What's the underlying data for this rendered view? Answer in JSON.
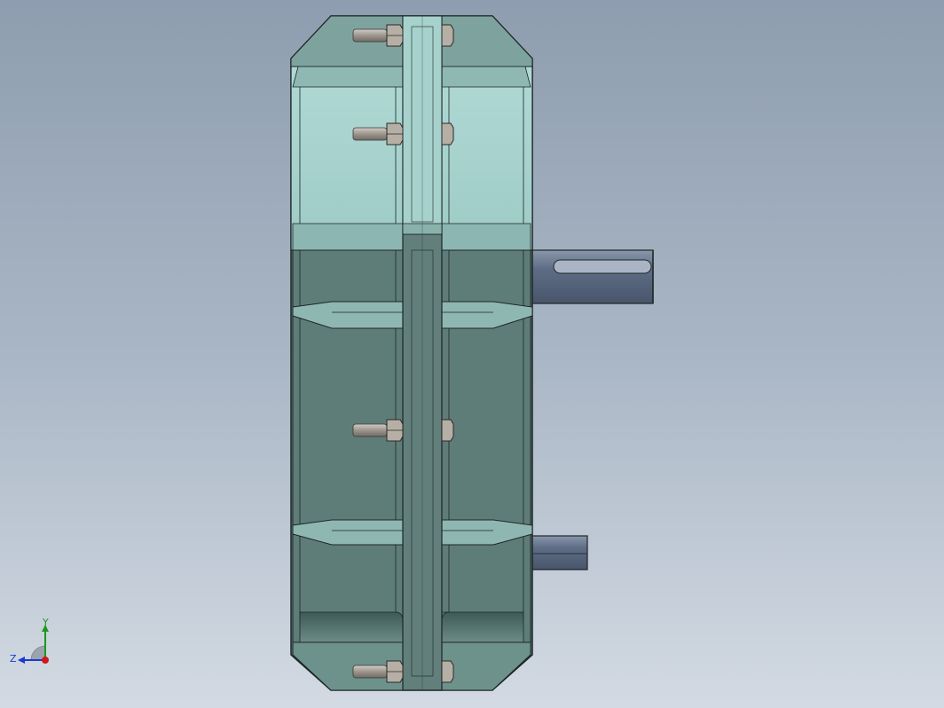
{
  "viewport": {
    "description_colors": {
      "housing_light": "#a9d3cf",
      "housing_mid": "#7fa39e",
      "housing_dark": "#5f7c78",
      "flange": "#658580",
      "rib": "#8fb7b1",
      "shaft": "#5c6e88",
      "bolt": "#a59f98",
      "outline": "#1c2626"
    }
  },
  "triad": {
    "y_label": "Y",
    "z_label": "Z",
    "x_color": "#d01818",
    "y_color": "#1a9a1a",
    "z_color": "#1a3ad0"
  }
}
